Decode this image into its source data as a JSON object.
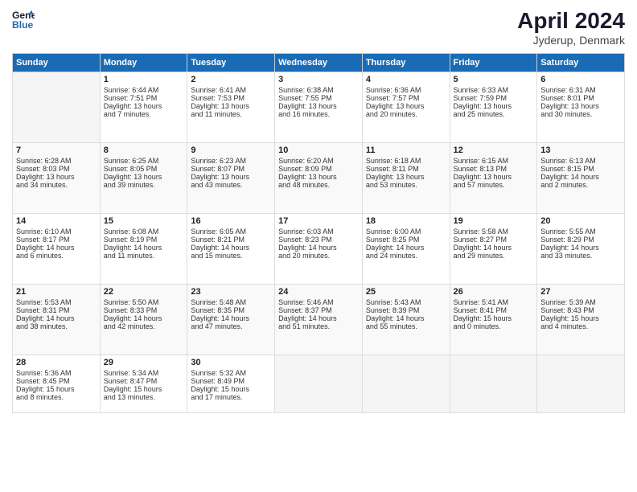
{
  "header": {
    "logo_line1": "General",
    "logo_line2": "Blue",
    "month": "April 2024",
    "location": "Jyderup, Denmark"
  },
  "weekdays": [
    "Sunday",
    "Monday",
    "Tuesday",
    "Wednesday",
    "Thursday",
    "Friday",
    "Saturday"
  ],
  "weeks": [
    [
      {
        "day": "",
        "text": ""
      },
      {
        "day": "1",
        "text": "Sunrise: 6:44 AM\nSunset: 7:51 PM\nDaylight: 13 hours\nand 7 minutes."
      },
      {
        "day": "2",
        "text": "Sunrise: 6:41 AM\nSunset: 7:53 PM\nDaylight: 13 hours\nand 11 minutes."
      },
      {
        "day": "3",
        "text": "Sunrise: 6:38 AM\nSunset: 7:55 PM\nDaylight: 13 hours\nand 16 minutes."
      },
      {
        "day": "4",
        "text": "Sunrise: 6:36 AM\nSunset: 7:57 PM\nDaylight: 13 hours\nand 20 minutes."
      },
      {
        "day": "5",
        "text": "Sunrise: 6:33 AM\nSunset: 7:59 PM\nDaylight: 13 hours\nand 25 minutes."
      },
      {
        "day": "6",
        "text": "Sunrise: 6:31 AM\nSunset: 8:01 PM\nDaylight: 13 hours\nand 30 minutes."
      }
    ],
    [
      {
        "day": "7",
        "text": "Sunrise: 6:28 AM\nSunset: 8:03 PM\nDaylight: 13 hours\nand 34 minutes."
      },
      {
        "day": "8",
        "text": "Sunrise: 6:25 AM\nSunset: 8:05 PM\nDaylight: 13 hours\nand 39 minutes."
      },
      {
        "day": "9",
        "text": "Sunrise: 6:23 AM\nSunset: 8:07 PM\nDaylight: 13 hours\nand 43 minutes."
      },
      {
        "day": "10",
        "text": "Sunrise: 6:20 AM\nSunset: 8:09 PM\nDaylight: 13 hours\nand 48 minutes."
      },
      {
        "day": "11",
        "text": "Sunrise: 6:18 AM\nSunset: 8:11 PM\nDaylight: 13 hours\nand 53 minutes."
      },
      {
        "day": "12",
        "text": "Sunrise: 6:15 AM\nSunset: 8:13 PM\nDaylight: 13 hours\nand 57 minutes."
      },
      {
        "day": "13",
        "text": "Sunrise: 6:13 AM\nSunset: 8:15 PM\nDaylight: 14 hours\nand 2 minutes."
      }
    ],
    [
      {
        "day": "14",
        "text": "Sunrise: 6:10 AM\nSunset: 8:17 PM\nDaylight: 14 hours\nand 6 minutes."
      },
      {
        "day": "15",
        "text": "Sunrise: 6:08 AM\nSunset: 8:19 PM\nDaylight: 14 hours\nand 11 minutes."
      },
      {
        "day": "16",
        "text": "Sunrise: 6:05 AM\nSunset: 8:21 PM\nDaylight: 14 hours\nand 15 minutes."
      },
      {
        "day": "17",
        "text": "Sunrise: 6:03 AM\nSunset: 8:23 PM\nDaylight: 14 hours\nand 20 minutes."
      },
      {
        "day": "18",
        "text": "Sunrise: 6:00 AM\nSunset: 8:25 PM\nDaylight: 14 hours\nand 24 minutes."
      },
      {
        "day": "19",
        "text": "Sunrise: 5:58 AM\nSunset: 8:27 PM\nDaylight: 14 hours\nand 29 minutes."
      },
      {
        "day": "20",
        "text": "Sunrise: 5:55 AM\nSunset: 8:29 PM\nDaylight: 14 hours\nand 33 minutes."
      }
    ],
    [
      {
        "day": "21",
        "text": "Sunrise: 5:53 AM\nSunset: 8:31 PM\nDaylight: 14 hours\nand 38 minutes."
      },
      {
        "day": "22",
        "text": "Sunrise: 5:50 AM\nSunset: 8:33 PM\nDaylight: 14 hours\nand 42 minutes."
      },
      {
        "day": "23",
        "text": "Sunrise: 5:48 AM\nSunset: 8:35 PM\nDaylight: 14 hours\nand 47 minutes."
      },
      {
        "day": "24",
        "text": "Sunrise: 5:46 AM\nSunset: 8:37 PM\nDaylight: 14 hours\nand 51 minutes."
      },
      {
        "day": "25",
        "text": "Sunrise: 5:43 AM\nSunset: 8:39 PM\nDaylight: 14 hours\nand 55 minutes."
      },
      {
        "day": "26",
        "text": "Sunrise: 5:41 AM\nSunset: 8:41 PM\nDaylight: 15 hours\nand 0 minutes."
      },
      {
        "day": "27",
        "text": "Sunrise: 5:39 AM\nSunset: 8:43 PM\nDaylight: 15 hours\nand 4 minutes."
      }
    ],
    [
      {
        "day": "28",
        "text": "Sunrise: 5:36 AM\nSunset: 8:45 PM\nDaylight: 15 hours\nand 8 minutes."
      },
      {
        "day": "29",
        "text": "Sunrise: 5:34 AM\nSunset: 8:47 PM\nDaylight: 15 hours\nand 13 minutes."
      },
      {
        "day": "30",
        "text": "Sunrise: 5:32 AM\nSunset: 8:49 PM\nDaylight: 15 hours\nand 17 minutes."
      },
      {
        "day": "",
        "text": ""
      },
      {
        "day": "",
        "text": ""
      },
      {
        "day": "",
        "text": ""
      },
      {
        "day": "",
        "text": ""
      }
    ]
  ]
}
